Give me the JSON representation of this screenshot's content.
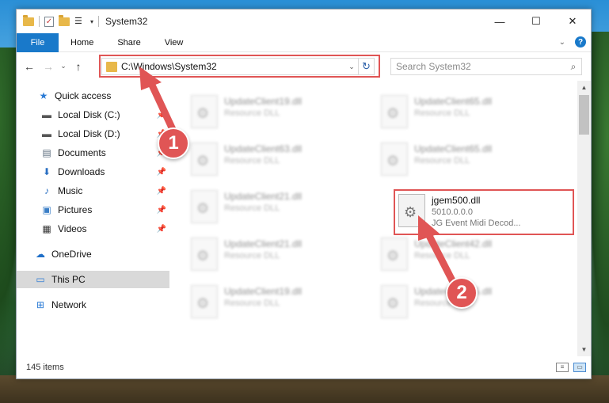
{
  "window": {
    "title": "System32",
    "controls": {
      "minimize": "—",
      "maximize": "☐",
      "close": "✕"
    }
  },
  "ribbon": {
    "file_tab": "File",
    "tabs": [
      "Home",
      "Share",
      "View"
    ],
    "help": "?"
  },
  "navbar": {
    "address": "C:\\Windows\\System32",
    "search_placeholder": "Search System32"
  },
  "sidebar": {
    "items": [
      {
        "label": "Quick access",
        "icon": "star-icon",
        "pinned": false
      },
      {
        "label": "Local Disk (C:)",
        "icon": "drive-icon",
        "pinned": true
      },
      {
        "label": "Local Disk (D:)",
        "icon": "drive-icon",
        "pinned": true
      },
      {
        "label": "Documents",
        "icon": "documents-icon",
        "pinned": true
      },
      {
        "label": "Downloads",
        "icon": "download-icon",
        "pinned": true
      },
      {
        "label": "Music",
        "icon": "music-icon",
        "pinned": true
      },
      {
        "label": "Pictures",
        "icon": "pictures-icon",
        "pinned": true
      },
      {
        "label": "Videos",
        "icon": "videos-icon",
        "pinned": true
      },
      {
        "label": "OneDrive",
        "icon": "cloud-icon",
        "pinned": false
      },
      {
        "label": "This PC",
        "icon": "computer-icon",
        "pinned": false,
        "selected": true
      },
      {
        "label": "Network",
        "icon": "network-icon",
        "pinned": false
      }
    ]
  },
  "files": [
    {
      "name": "UpdateClient19.dll",
      "desc": "Resource DLL"
    },
    {
      "name": "UpdateClient65.dll",
      "desc": "Resource DLL"
    },
    {
      "name": "UpdateClient63.dll",
      "desc": "Resource DLL"
    },
    {
      "name": "UpdateClient65.dll",
      "desc": "Resource DLL"
    },
    {
      "name": "UpdateClient21.dll",
      "desc": "Resource DLL"
    },
    {
      "name": "jgem500.dll",
      "version": "5010.0.0.0",
      "desc": "JG Event Midi Decod...",
      "highlighted": true
    },
    {
      "name": "UpdateClient21.dll",
      "desc": "Resource DLL"
    },
    {
      "name": "UpdateClient42.dll",
      "desc": "Resource DLL"
    },
    {
      "name": "UpdateClient19.dll",
      "desc": "Resource DLL"
    },
    {
      "name": "UpdateClient65.dll",
      "desc": "Resource DLL"
    }
  ],
  "statusbar": {
    "count": "145 items"
  },
  "annotations": {
    "step1": "1",
    "step2": "2"
  },
  "colors": {
    "accent": "#1979ca",
    "highlight": "#e05555"
  }
}
